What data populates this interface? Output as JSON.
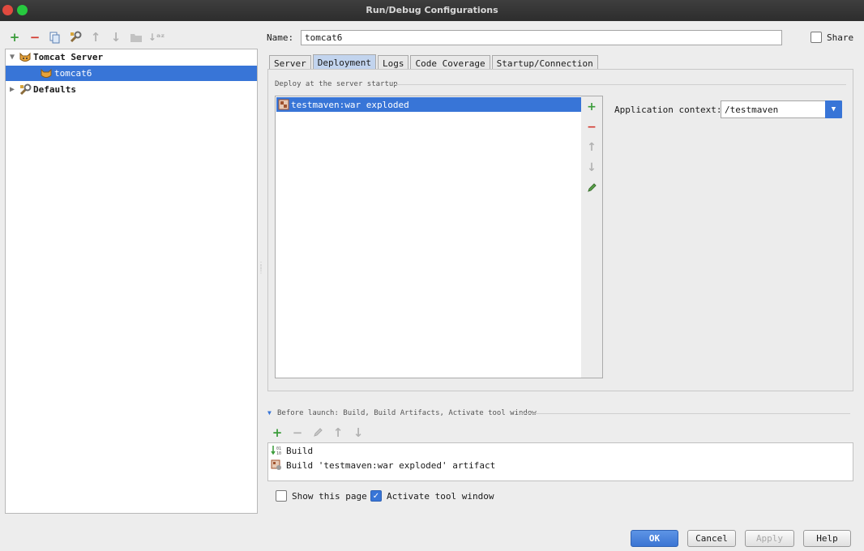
{
  "window": {
    "title": "Run/Debug Configurations"
  },
  "toolbar": {
    "icons": [
      "plus-icon",
      "minus-icon",
      "copy-icon",
      "wrench-icon",
      "arrow-up-icon",
      "arrow-down-icon",
      "folder-icon",
      "sort-icon"
    ]
  },
  "tree": {
    "items": [
      {
        "label": "Tomcat Server",
        "icon": "tomcat-icon",
        "expanded": true
      },
      {
        "label": "tomcat6",
        "icon": "tomcat-config-icon",
        "selected": true
      },
      {
        "label": "Defaults",
        "icon": "wrench-icon",
        "expanded": false
      }
    ]
  },
  "name_field": {
    "label": "Name:",
    "value": "tomcat6"
  },
  "share": {
    "label": "Share",
    "checked": false
  },
  "tabs": [
    {
      "label": "Server",
      "active": false
    },
    {
      "label": "Deployment",
      "active": true
    },
    {
      "label": "Logs",
      "active": false
    },
    {
      "label": "Code Coverage",
      "active": false
    },
    {
      "label": "Startup/Connection",
      "active": false
    }
  ],
  "deployment": {
    "section_title": "Deploy at the server startup",
    "items": [
      {
        "label": "testmaven:war exploded",
        "selected": true
      }
    ],
    "app_context_label": "Application context:",
    "app_context_value": "/testmaven"
  },
  "before_launch": {
    "title": "Before launch: Build, Build Artifacts, Activate tool window",
    "items": [
      {
        "label": "Build",
        "icon": "build-icon"
      },
      {
        "label": "Build 'testmaven:war exploded' artifact",
        "icon": "artifact-icon"
      }
    ]
  },
  "options": {
    "show_page": {
      "label": "Show this page",
      "checked": false
    },
    "activate_tool": {
      "label": "Activate tool window",
      "checked": true
    }
  },
  "buttons": {
    "ok": "OK",
    "cancel": "Cancel",
    "apply": "Apply",
    "help": "Help"
  },
  "colors": {
    "selection": "#3875d7",
    "add_green": "#3a9c3a",
    "remove_red": "#d33a2f"
  }
}
